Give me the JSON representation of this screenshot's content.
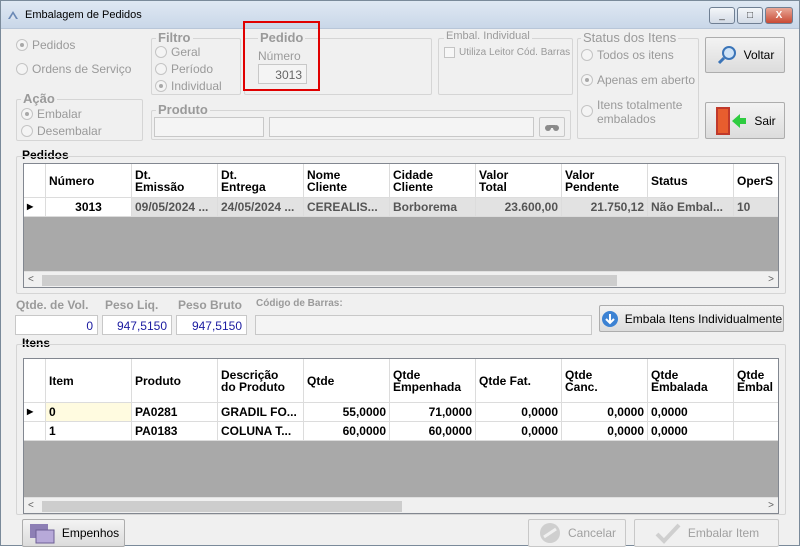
{
  "window": {
    "title": "Embalagem de Pedidos",
    "min": "_",
    "max": "□",
    "close": "X"
  },
  "tipo": {
    "pedidos": "Pedidos",
    "ordens": "Ordens de Serviço"
  },
  "acao": {
    "legend": "Ação",
    "embalar": "Embalar",
    "desembalar": "Desembalar"
  },
  "filtro": {
    "legend": "Filtro",
    "geral": "Geral",
    "periodo": "Período",
    "individual": "Individual"
  },
  "pedido": {
    "legend": "Pedido",
    "numero_label": "Número",
    "numero_value": "3013"
  },
  "embal_individual": {
    "legend": "Embal. Individual",
    "leitor": "Utiliza Leitor Cód. Barras"
  },
  "produto": {
    "legend": "Produto"
  },
  "status_itens": {
    "legend": "Status dos Itens",
    "todos": "Todos os itens",
    "abertos": "Apenas em aberto",
    "totalmente_1": "Itens totalmente",
    "totalmente_2": "embalados"
  },
  "buttons": {
    "voltar": "Voltar",
    "sair": "Sair",
    "embala_individual": "Embala Itens Individualmente",
    "empenhos": "Empenhos",
    "cancelar": "Cancelar",
    "embalar_item": "Embalar Item"
  },
  "pedidos_section": "Pedidos",
  "pedidos_table": {
    "headers": [
      "Número",
      "Dt.\nEmissão",
      "Dt.\nEntrega",
      "Nome\nCliente",
      "Cidade\nCliente",
      "Valor\nTotal",
      "Valor\nPendente",
      "Status",
      "OperS"
    ],
    "rows": [
      [
        "3013",
        "09/05/2024 ...",
        "24/05/2024 ...",
        "CEREALIS...",
        "Borborema",
        "23.600,00",
        "21.750,12",
        "Não Embal...",
        "10"
      ]
    ]
  },
  "totals": {
    "vol_label": "Qtde. de Vol.",
    "vol_value": "0",
    "peso_liq_label": "Peso Liq.",
    "peso_liq_value": "947,5150",
    "peso_bruto_label": "Peso Bruto",
    "peso_bruto_value": "947,5150",
    "cod_barras_label": "Código de Barras:"
  },
  "itens_section": "Itens",
  "itens_table": {
    "headers": [
      "Item",
      "Produto",
      "Descrição\ndo Produto",
      "Qtde",
      "Qtde\nEmpenhada",
      "Qtde Fat.",
      "Qtde\nCanc.",
      "Qtde\nEmbalada",
      "Qtde\nEmbal"
    ],
    "rows": [
      [
        "0",
        "PA0281",
        "GRADIL FO...",
        "55,0000",
        "71,0000",
        "0,0000",
        "0,0000",
        "0,0000",
        ""
      ],
      [
        "1",
        "PA0183",
        "COLUNA T...",
        "60,0000",
        "60,0000",
        "0,0000",
        "0,0000",
        "0,0000",
        ""
      ]
    ]
  },
  "colors": {
    "highlight": "#e00000",
    "value_text": "#1a1aa0"
  }
}
